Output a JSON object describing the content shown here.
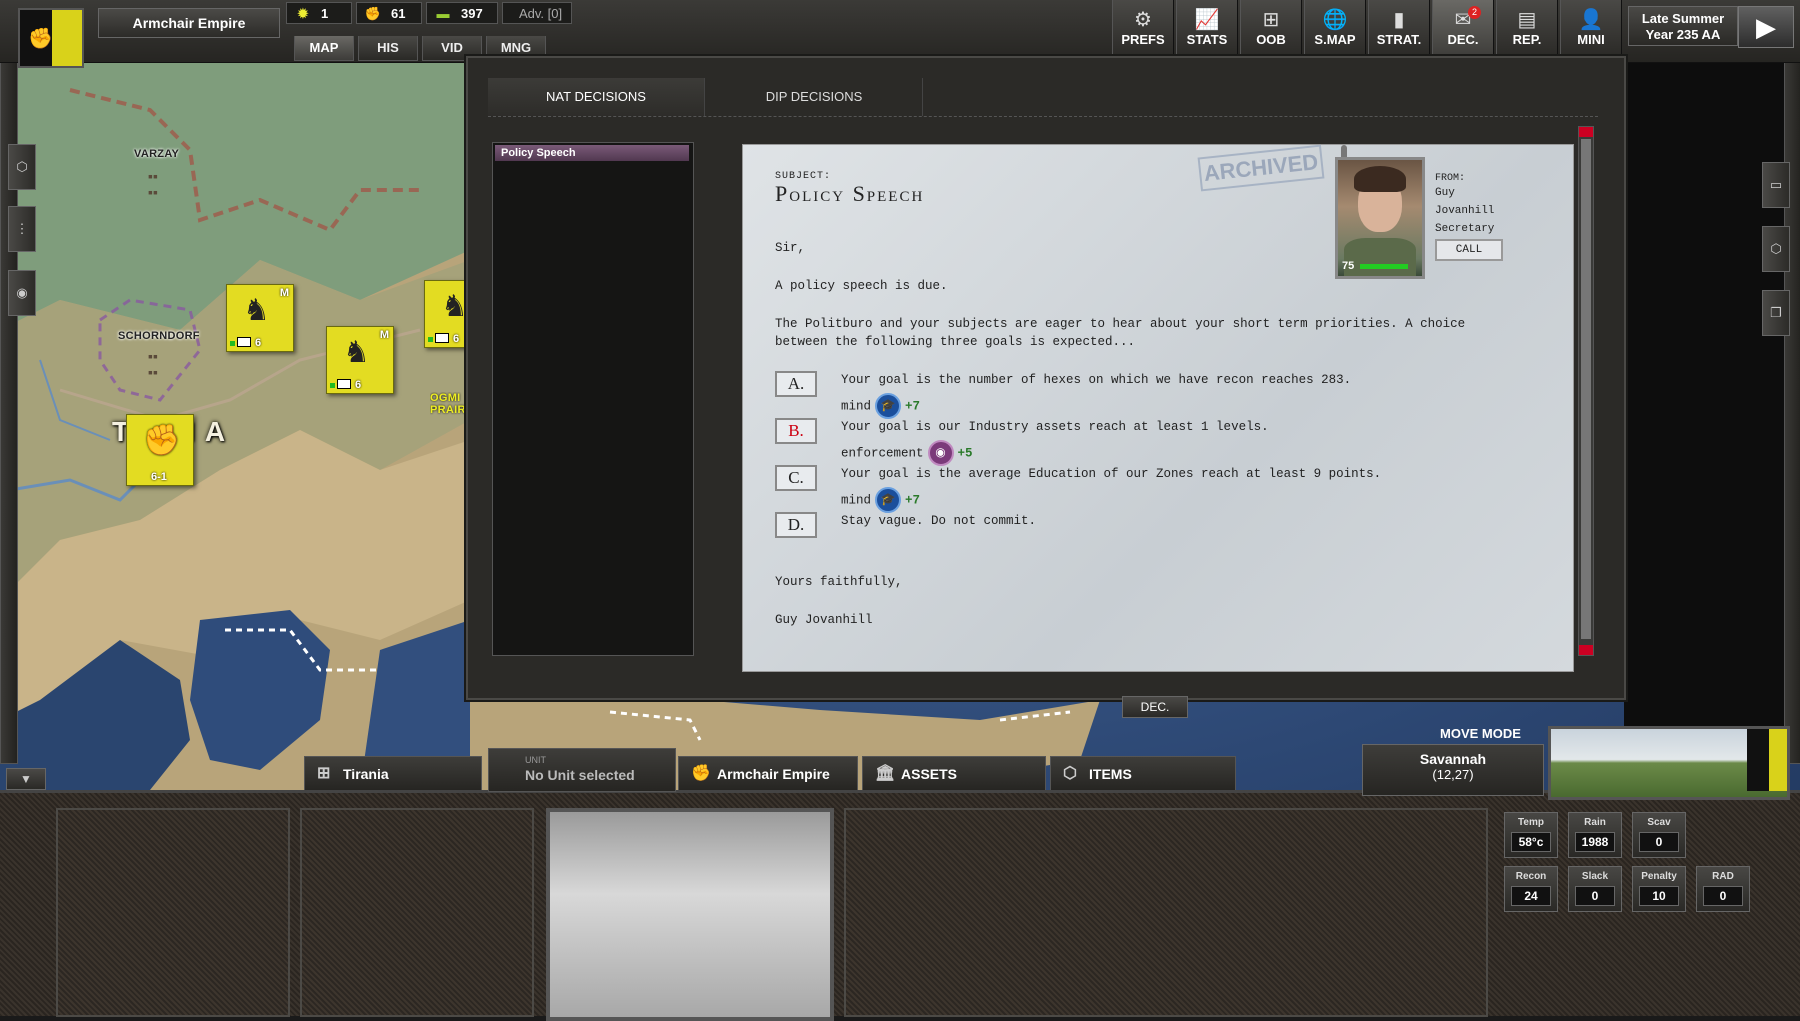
{
  "topbar": {
    "nation": "Armchair Empire",
    "resources": [
      {
        "icon": "sun-icon",
        "value": "1"
      },
      {
        "icon": "fist-icon",
        "value": "61"
      },
      {
        "icon": "cash-icon",
        "value": "397"
      }
    ],
    "adv": "Adv. [0]",
    "nav_tabs": [
      "MAP",
      "HIS",
      "VID",
      "MNG"
    ],
    "buttons": [
      {
        "label": "PREFS",
        "icon": "gear-icon",
        "glyph": "⚙"
      },
      {
        "label": "STATS",
        "icon": "chart-icon",
        "glyph": "📈"
      },
      {
        "label": "OOB",
        "icon": "hierarchy-icon",
        "glyph": "⊞"
      },
      {
        "label": "S.MAP",
        "icon": "globe-icon",
        "glyph": "🌐"
      },
      {
        "label": "STRAT.",
        "icon": "cards-icon",
        "glyph": "▮"
      },
      {
        "label": "DEC.",
        "icon": "mail-icon",
        "glyph": "✉",
        "badge": "2"
      },
      {
        "label": "REP.",
        "icon": "report-icon",
        "glyph": "▤"
      },
      {
        "label": "MINI",
        "icon": "person-icon",
        "glyph": "👤"
      }
    ],
    "season_line1": "Late Summer",
    "season_line2": "Year 235 AA"
  },
  "map": {
    "cities": [
      {
        "name": "VARZAY"
      },
      {
        "name": "SCHORNDORF"
      },
      {
        "name": "OGMI PRAIR"
      }
    ],
    "region": "T    NIA",
    "units": [
      {
        "letter": "M",
        "strength": "6"
      },
      {
        "letter": "M",
        "strength": "6"
      },
      {
        "letter": "M",
        "strength": "6"
      }
    ],
    "hq_strength": "6-1"
  },
  "panel": {
    "tabs": [
      "NAT DECISIONS",
      "DIP DECISIONS"
    ],
    "list_items": [
      "Policy Speech"
    ],
    "letter": {
      "subject_label": "SUBJECT:",
      "subject": "Policy Speech",
      "stamp": "ARCHIVED",
      "salutation": "Sir,",
      "p1": "A policy speech is due.",
      "p2a": "The Politburo and your subjects are eager to hear about your short term priorities. A choice",
      "p2b": "between the following three goals is expected...",
      "options": [
        {
          "key": "A.",
          "text": "Your goal is the number of hexes on which we have recon reaches 283.",
          "effect": "mind",
          "effect_icon": "mind-icon",
          "value": "+7"
        },
        {
          "key": "B.",
          "text": "Your goal is our Industry assets reach at least 1 levels.",
          "effect": "enforcement",
          "effect_icon": "eye-icon",
          "value": "+5"
        },
        {
          "key": "C.",
          "text": "Your goal is the average Education of our Zones reach at least 9 points.",
          "effect": "mind",
          "effect_icon": "mind-icon",
          "value": "+7"
        },
        {
          "key": "D.",
          "text": "Stay vague. Do not commit."
        }
      ],
      "closing": "Yours faithfully,",
      "signature": "Guy Jovanhill",
      "from_label": "FROM:",
      "from_first": "Guy",
      "from_last": "Jovanhill",
      "from_role": "Secretary",
      "call": "CALL",
      "portrait_score": "75"
    }
  },
  "bottom": {
    "dec_tab": "DEC.",
    "move_mode": "MOVE MODE",
    "tabs": [
      {
        "label": "Tirania",
        "icon": "hierarchy-icon"
      },
      {
        "label": "Armchair Empire",
        "icon": "fist-icon"
      },
      {
        "label": "ASSETS",
        "icon": "building-icon"
      },
      {
        "label": "ITEMS",
        "icon": "box-icon"
      }
    ],
    "unit_small": "UNIT",
    "unit_text": "No Unit selected",
    "location_name": "Savannah",
    "location_coords": "(12,27)",
    "stats": [
      {
        "label": "Temp",
        "value": "58°c"
      },
      {
        "label": "Rain",
        "value": "1988"
      },
      {
        "label": "Scav",
        "value": "0"
      },
      {
        "label": "Recon",
        "value": "24"
      },
      {
        "label": "Slack",
        "value": "0"
      },
      {
        "label": "Penalty",
        "value": "10"
      },
      {
        "label": "RAD",
        "value": "0"
      }
    ]
  },
  "colors": {
    "nation_yellow": "#d9d21a",
    "sea": "#2e4a78",
    "land": "#c7b487",
    "forest": "#7a9a72",
    "paper": "#d6dbdf",
    "list_select": "#6a4a68",
    "option_b": "#cc0011"
  }
}
